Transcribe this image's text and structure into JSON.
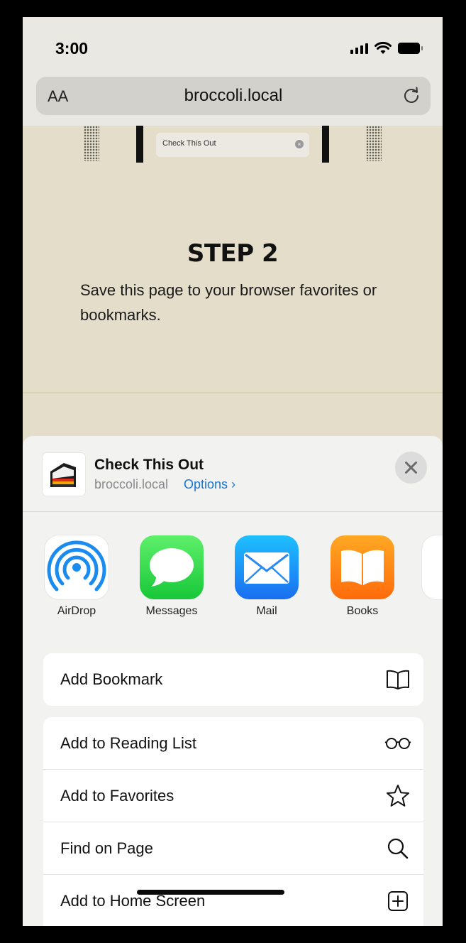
{
  "status_bar": {
    "time": "3:00"
  },
  "url_bar": {
    "text_size_label": "AA",
    "url": "broccoli.local"
  },
  "page": {
    "preview_pill": "Check This Out",
    "step_title": "STEP 2",
    "step_description": "Save this page to your browser favorites or bookmarks."
  },
  "share_sheet": {
    "title": "Check This Out",
    "domain": "broccoli.local",
    "options_label": "Options ›",
    "apps": [
      {
        "label": "AirDrop",
        "icon": "airdrop-icon"
      },
      {
        "label": "Messages",
        "icon": "messages-icon"
      },
      {
        "label": "Mail",
        "icon": "mail-icon"
      },
      {
        "label": "Books",
        "icon": "books-icon"
      }
    ],
    "actions_group1": [
      {
        "label": "Add Bookmark",
        "icon": "book-icon"
      }
    ],
    "actions_group2": [
      {
        "label": "Add to Reading List",
        "icon": "glasses-icon"
      },
      {
        "label": "Add to Favorites",
        "icon": "star-icon"
      },
      {
        "label": "Find on Page",
        "icon": "search-icon"
      },
      {
        "label": "Add to Home Screen",
        "icon": "plus-square-icon"
      }
    ]
  },
  "colors": {
    "page_bg": "#e3ddc9",
    "sheet_bg": "#f2f2f0",
    "link_blue": "#1877d4"
  }
}
